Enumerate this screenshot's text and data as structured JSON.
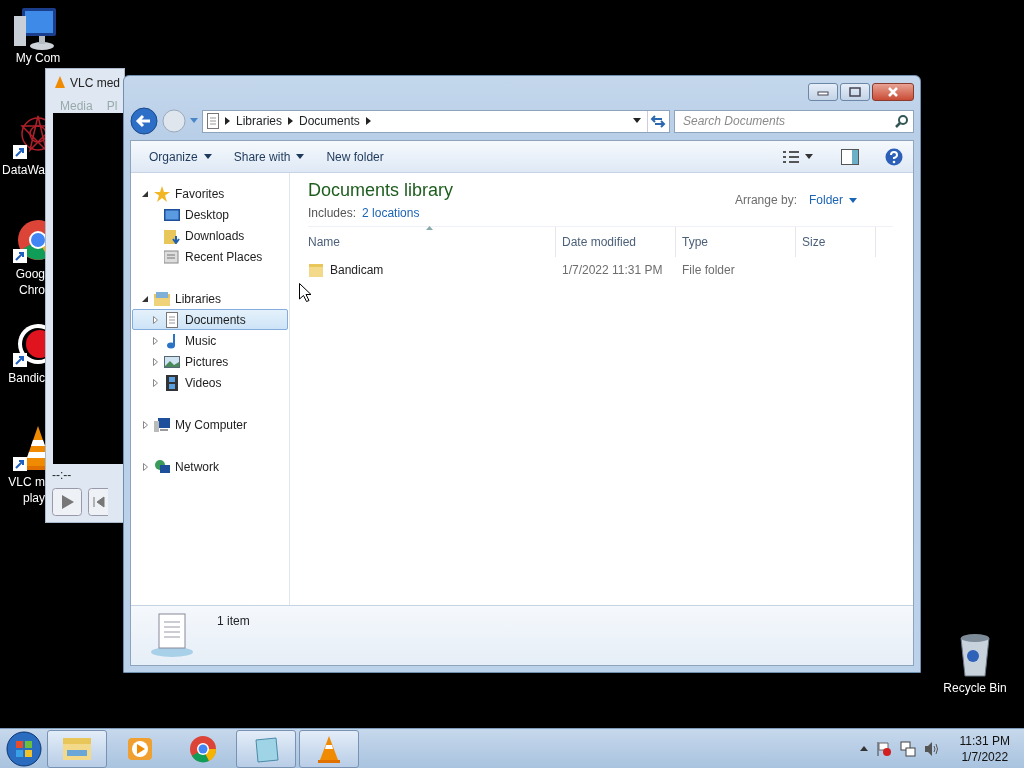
{
  "desktop_icons": [
    {
      "kind": "computer",
      "shortcut": false,
      "lines": [
        "My Com"
      ]
    },
    {
      "kind": "datawave",
      "shortcut": true,
      "lines": [
        "DataWa"
      ]
    },
    {
      "kind": "chrome",
      "shortcut": true,
      "lines": [
        "Goog",
        "Chro"
      ]
    },
    {
      "kind": "bandicam",
      "shortcut": true,
      "lines": [
        "Bandic"
      ]
    },
    {
      "kind": "vlc",
      "shortcut": true,
      "lines": [
        "VLC m",
        "play"
      ]
    }
  ],
  "recycle_bin": {
    "label": "Recycle Bin"
  },
  "vlc_window": {
    "title": "VLC med",
    "menu": [
      "Media",
      "Pl"
    ],
    "time": "--:--"
  },
  "explorer": {
    "address": [
      "Libraries",
      "Documents"
    ],
    "search": {
      "placeholder": "Search Documents"
    },
    "toolbar": [
      {
        "label": "Organize",
        "dropdown": true
      },
      {
        "label": "Share with",
        "dropdown": true
      },
      {
        "label": "New folder",
        "dropdown": false
      }
    ],
    "navigation": [
      {
        "kind": "favorites",
        "label": "Favorites",
        "expanded": true,
        "selected": false,
        "children": [
          {
            "kind": "desktop",
            "label": "Desktop",
            "selected": false,
            "has_children": false
          },
          {
            "kind": "downloads",
            "label": "Downloads",
            "selected": false,
            "has_children": false
          },
          {
            "kind": "recent",
            "label": "Recent Places",
            "selected": false,
            "has_children": false
          }
        ]
      },
      {
        "kind": "libraries",
        "label": "Libraries",
        "expanded": true,
        "selected": false,
        "children": [
          {
            "kind": "documents",
            "label": "Documents",
            "selected": true,
            "has_children": true
          },
          {
            "kind": "music",
            "label": "Music",
            "selected": false,
            "has_children": true
          },
          {
            "kind": "pictures",
            "label": "Pictures",
            "selected": false,
            "has_children": true
          },
          {
            "kind": "videos",
            "label": "Videos",
            "selected": false,
            "has_children": true
          }
        ]
      },
      {
        "kind": "computer",
        "label": "My Computer",
        "expanded": false,
        "selected": false
      },
      {
        "kind": "network",
        "label": "Network",
        "expanded": false,
        "selected": false
      }
    ],
    "library": {
      "title": "Documents library",
      "includes_label": "Includes:",
      "locations_link": "2 locations",
      "arrange_label": "Arrange by:",
      "arrange_value": "Folder"
    },
    "columns": [
      "Name",
      "Date modified",
      "Type",
      "Size"
    ],
    "rows": [
      {
        "name": "Bandicam",
        "date_modified": "1/7/2022 11:31 PM",
        "type": "File folder"
      }
    ],
    "status": "1 item"
  },
  "taskbar": {
    "items": [
      {
        "kind": "explorer",
        "running": true
      },
      {
        "kind": "media",
        "running": false
      },
      {
        "kind": "chrome",
        "running": false
      },
      {
        "kind": "notepad",
        "running": true
      },
      {
        "kind": "vlc",
        "running": true
      }
    ],
    "clock": {
      "time": "11:31 PM",
      "date": "1/7/2022"
    }
  }
}
